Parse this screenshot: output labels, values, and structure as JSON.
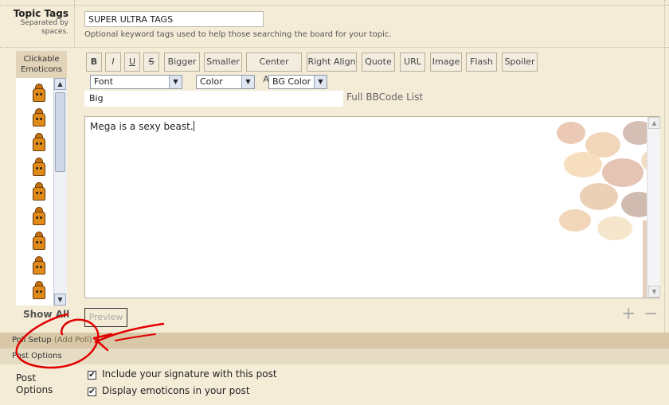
{
  "topic_tags": {
    "label": "Topic Tags",
    "sublabel_line1": "Separated by",
    "sublabel_line2": "spaces.",
    "value": "SUPER ULTRA TAGS",
    "hint": "Optional keyword tags used to help those searching the board for your topic."
  },
  "emoticons": {
    "header_line1": "Clickable",
    "header_line2": "Emoticons",
    "items": [
      "hydrant-emoticon-1",
      "hydrant-emoticon-2",
      "hydrant-emoticon-3",
      "hydrant-emoticon-4",
      "hydrant-emoticon-5",
      "hydrant-emoticon-6",
      "hydrant-emoticon-7",
      "hydrant-emoticon-8",
      "hydrant-emoticon-9"
    ],
    "show_all": "Show All"
  },
  "toolbar": {
    "buttons": [
      "B",
      "I",
      "U",
      "S",
      "Bigger",
      "Smaller",
      "Center Align",
      "Right Align",
      "Quote",
      "URL",
      "Image",
      "Flash",
      "Spoiler"
    ],
    "font_select": "Font",
    "color_select": "Color",
    "bgcolor_select": "BG Color",
    "size_value": "Big",
    "full_bbcode_link": "Full BBCode List"
  },
  "editor": {
    "content": "Mega is a sexy beast."
  },
  "actions": {
    "preview": "Preview",
    "plus": "+",
    "minus": "−"
  },
  "sections": {
    "poll_setup": "Poll Setup",
    "add_poll": "(Add Poll)",
    "post_options": "Post Options"
  },
  "post_options": {
    "label_line1": "Post",
    "label_line2": "Options",
    "signature": "Include your signature with this post",
    "emoticons": "Display emoticons in your post",
    "signature_checked": true,
    "emoticons_checked": true
  },
  "colors": {
    "page_bg": "#f5ecd7",
    "band_dark": "#d8c8a8",
    "annotation_red": "#e00000"
  }
}
